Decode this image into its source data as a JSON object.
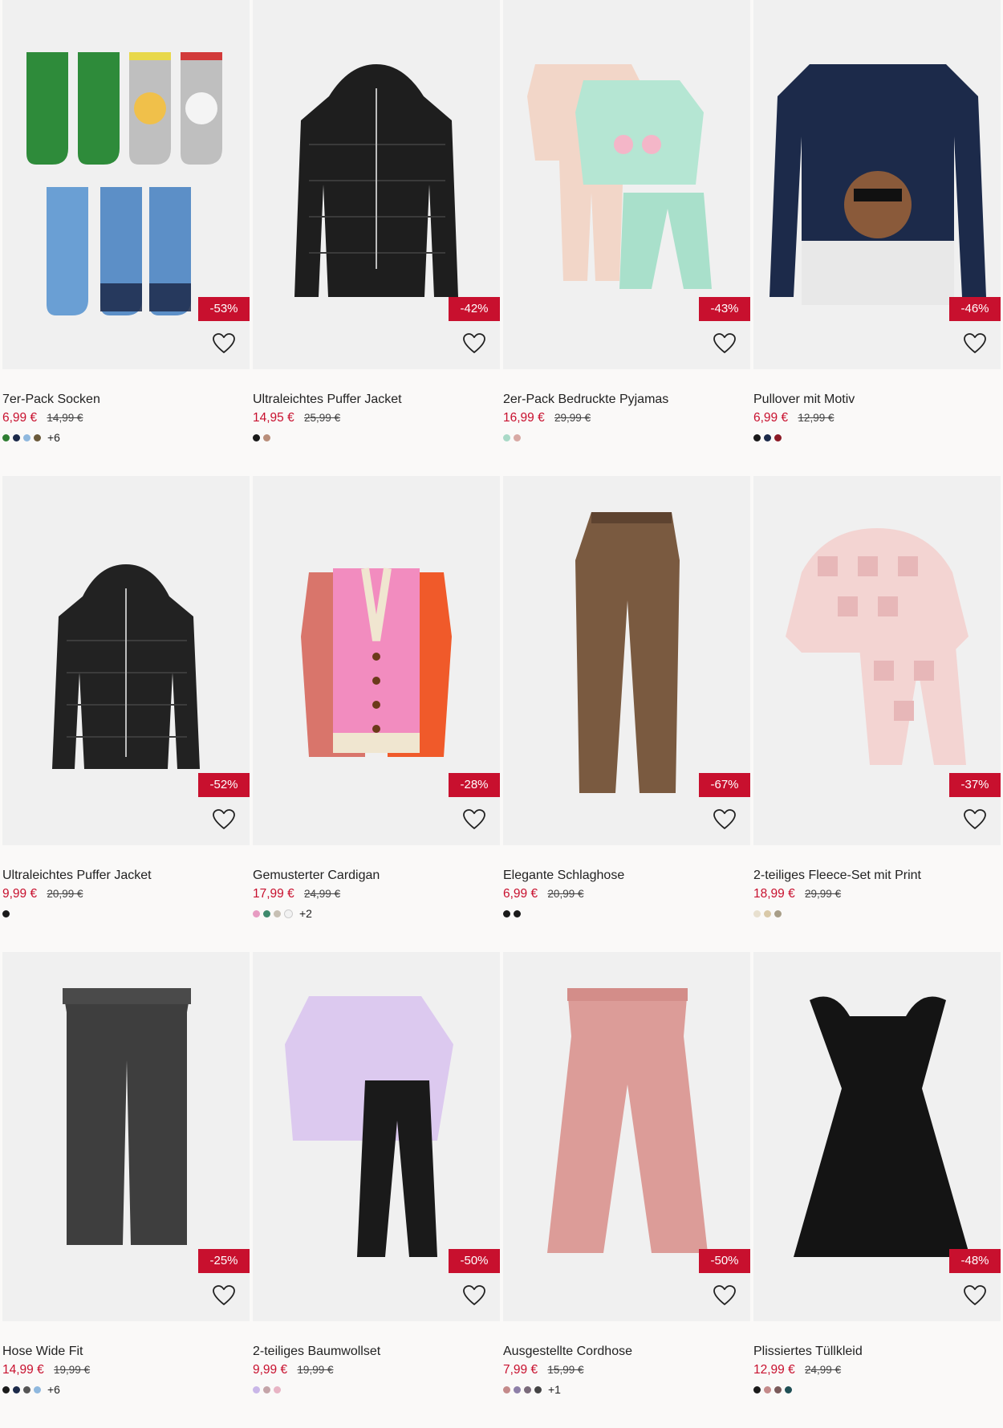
{
  "products": [
    {
      "name": "7er-Pack Socken",
      "price": "6,99 €",
      "old_price": "14,99 €",
      "discount": "-53%",
      "colors": [
        "#2e7d32",
        "#1c2a4a",
        "#8fb8de",
        "#6b5a3a"
      ],
      "more": "+6",
      "art": "socks"
    },
    {
      "name": "Ultraleichtes Puffer Jacket",
      "price": "14,95 €",
      "old_price": "25,99 €",
      "discount": "-42%",
      "colors": [
        "#1a1a1a",
        "#b98e7a"
      ],
      "more": "",
      "art": "puffer"
    },
    {
      "name": "2er-Pack Bedruckte Pyjamas",
      "price": "16,99 €",
      "old_price": "29,99 €",
      "discount": "-43%",
      "colors": [
        "#a9d9c7",
        "#d8a9a4"
      ],
      "more": "",
      "art": "pyjamas"
    },
    {
      "name": "Pullover mit Motiv",
      "price": "6,99 €",
      "old_price": "12,99 €",
      "discount": "-46%",
      "colors": [
        "#1a1a1a",
        "#1c2a4a",
        "#8c1a26"
      ],
      "more": "",
      "art": "sweater"
    },
    {
      "name": "Ultraleichtes Puffer Jacket",
      "price": "9,99 €",
      "old_price": "20,99 €",
      "discount": "-52%",
      "colors": [
        "#1a1a1a"
      ],
      "more": "",
      "art": "puffer2"
    },
    {
      "name": "Gemusterter Cardigan",
      "price": "17,99 €",
      "old_price": "24,99 €",
      "discount": "-28%",
      "colors": [
        "#e79cc2",
        "#3e8a6d",
        "#c7c0b4",
        "#f2f2f2"
      ],
      "more": "+2",
      "art": "cardigan"
    },
    {
      "name": "Elegante Schlaghose",
      "price": "6,99 €",
      "old_price": "20,99 €",
      "discount": "-67%",
      "colors": [
        "#1a1a1a",
        "#1a1a1a"
      ],
      "more": "",
      "art": "flares"
    },
    {
      "name": "2-teiliges Fleece-Set mit Print",
      "price": "18,99 €",
      "old_price": "29,99 €",
      "discount": "-37%",
      "colors": [
        "#e8e0cf",
        "#d9c9a8",
        "#a89e88"
      ],
      "more": "",
      "art": "fleece"
    },
    {
      "name": "Hose Wide Fit",
      "price": "14,99 €",
      "old_price": "19,99 €",
      "discount": "-25%",
      "colors": [
        "#1a1a1a",
        "#1c2a4a",
        "#555555",
        "#8fb8de"
      ],
      "more": "+6",
      "art": "jeans"
    },
    {
      "name": "2-teiliges Baumwollset",
      "price": "9,99 €",
      "old_price": "19,99 €",
      "discount": "-50%",
      "colors": [
        "#c9b7e8",
        "#c4a4a8",
        "#e8b4c4"
      ],
      "more": "",
      "art": "cotton"
    },
    {
      "name": "Ausgestellte Cordhose",
      "price": "7,99 €",
      "old_price": "15,99 €",
      "discount": "-50%",
      "colors": [
        "#c48a8a",
        "#8d7fa8",
        "#7a6a7a",
        "#444444"
      ],
      "more": "+1",
      "art": "cord"
    },
    {
      "name": "Plissiertes Tüllkleid",
      "price": "12,99 €",
      "old_price": "24,99 €",
      "discount": "-48%",
      "colors": [
        "#1a1a1a",
        "#c48a8a",
        "#7a5a5a",
        "#1f4f55"
      ],
      "more": "",
      "art": "dress"
    }
  ]
}
